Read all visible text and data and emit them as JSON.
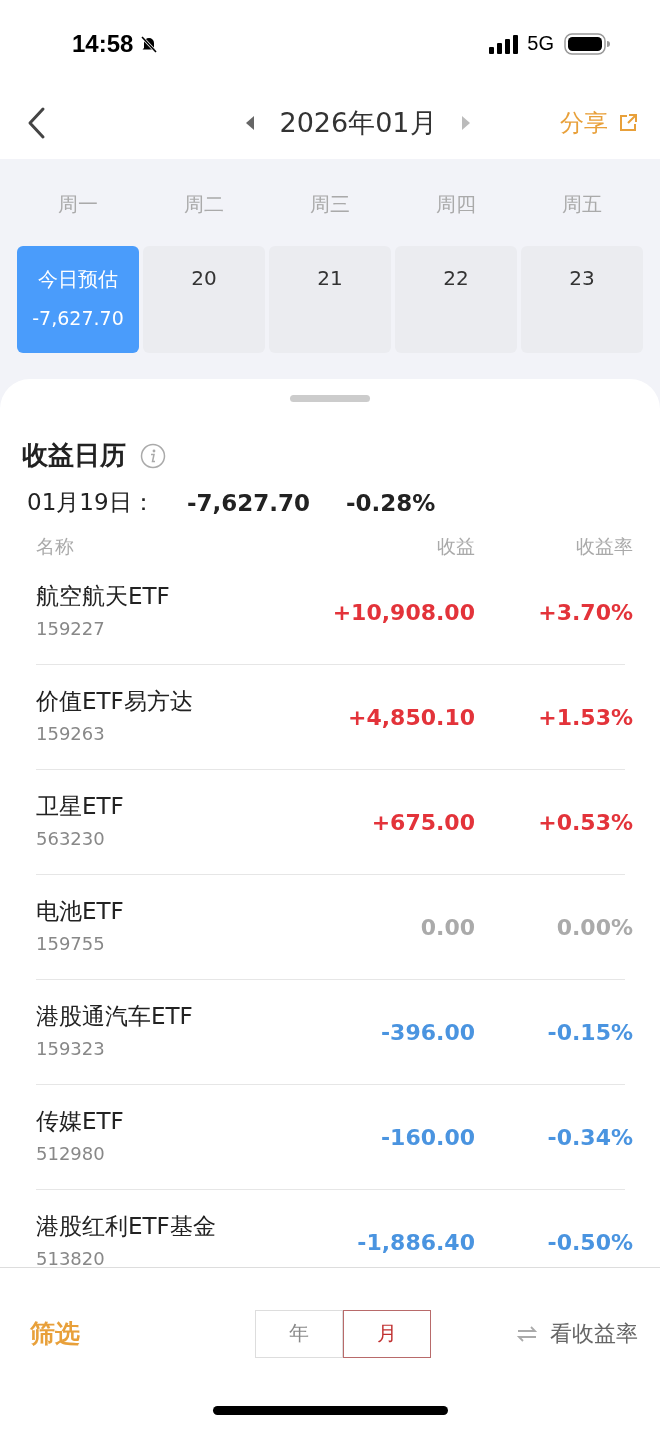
{
  "status_bar": {
    "time": "14:58",
    "network": "5G"
  },
  "nav": {
    "month": "2026年01月",
    "share": "分享"
  },
  "weekdays": [
    "周一",
    "周二",
    "周三",
    "周四",
    "周五"
  ],
  "days": [
    {
      "label": "今日预估",
      "amount": "-7,627.70",
      "selected": true
    },
    {
      "label": "20",
      "selected": false
    },
    {
      "label": "21",
      "selected": false
    },
    {
      "label": "22",
      "selected": false
    },
    {
      "label": "23",
      "selected": false
    }
  ],
  "sheet": {
    "title": "收益日历",
    "date": "01月19日：",
    "amount": "-7,627.70",
    "rate": "-0.28%"
  },
  "columns": [
    "名称",
    "收益",
    "收益率"
  ],
  "rows": [
    {
      "name": "航空航天ETF",
      "code": "159227",
      "profit": "+10,908.00",
      "rate": "+3.70%",
      "color": "#e3333a"
    },
    {
      "name": "价值ETF易方达",
      "code": "159263",
      "profit": "+4,850.10",
      "rate": "+1.53%",
      "color": "#e3333a"
    },
    {
      "name": "卫星ETF",
      "code": "563230",
      "profit": "+675.00",
      "rate": "+0.53%",
      "color": "#e3333a"
    },
    {
      "name": "电池ETF",
      "code": "159755",
      "profit": "0.00",
      "rate": "0.00%",
      "color": "#aaaaaa"
    },
    {
      "name": "港股通汽车ETF",
      "code": "159323",
      "profit": "-396.00",
      "rate": "-0.15%",
      "color": "#4a94e0"
    },
    {
      "name": "传媒ETF",
      "code": "512980",
      "profit": "-160.00",
      "rate": "-0.34%",
      "color": "#4a94e0"
    },
    {
      "name": "港股红利ETF基金",
      "code": "513820",
      "profit": "-1,886.40",
      "rate": "-0.50%",
      "color": "#4a94e0"
    }
  ],
  "footer": {
    "filter": "筛选",
    "periods": [
      {
        "label": "年",
        "selected": false
      },
      {
        "label": "月",
        "selected": true
      }
    ],
    "toggle": "看收益率"
  }
}
